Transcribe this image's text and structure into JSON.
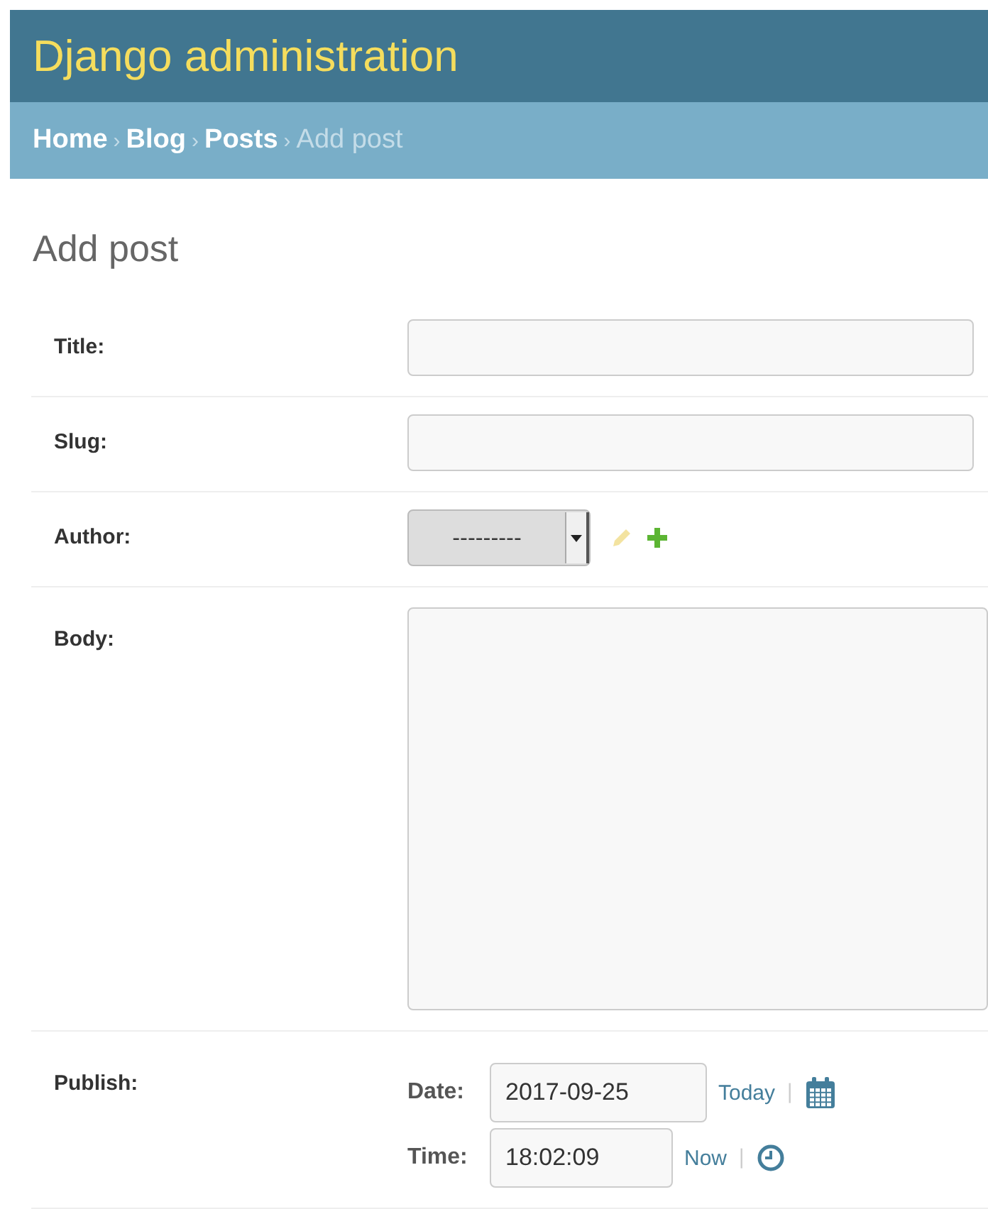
{
  "header": {
    "title": "Django administration"
  },
  "breadcrumbs": [
    {
      "label": "Home",
      "current": false
    },
    {
      "label": "Blog",
      "current": false
    },
    {
      "label": "Posts",
      "current": false
    },
    {
      "label": "Add post",
      "current": true
    }
  ],
  "breadcrumb_separator": "›",
  "page_title": "Add post",
  "fields": [
    {
      "kind": "text",
      "label": "Title:"
    },
    {
      "kind": "text",
      "label": "Slug:"
    },
    {
      "kind": "select",
      "label": "Author:",
      "value": "---------"
    },
    {
      "kind": "textarea",
      "label": "Body:"
    },
    {
      "kind": "datetime",
      "label": "Publish:",
      "parts": [
        {
          "kind": "date",
          "label": "Date:",
          "value": "2017-09-25",
          "shortcut": "Today",
          "separator": "|"
        },
        {
          "kind": "time",
          "label": "Time:",
          "value": "18:02:09",
          "shortcut": "Now",
          "separator": "|"
        }
      ]
    }
  ]
}
